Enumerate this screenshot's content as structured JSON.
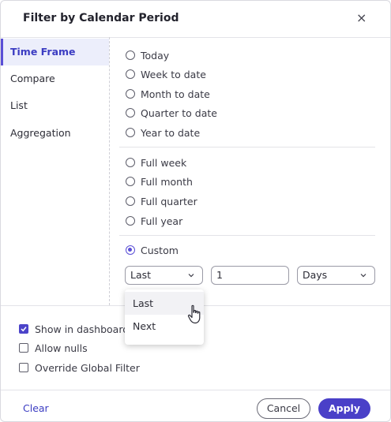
{
  "dialog": {
    "title": "Filter by Calendar Period",
    "close_icon": "×"
  },
  "sidebar": {
    "items": [
      {
        "label": "Time Frame",
        "active": true
      },
      {
        "label": "Compare"
      },
      {
        "label": "List"
      },
      {
        "label": "Aggregation"
      }
    ]
  },
  "options": {
    "group1": [
      "Today",
      "Week to date",
      "Month to date",
      "Quarter to date",
      "Year to date"
    ],
    "group2": [
      "Full week",
      "Full month",
      "Full quarter",
      "Full year"
    ],
    "custom": "Custom",
    "selected": "Custom"
  },
  "custom_fields": {
    "direction_value": "Last",
    "number_value": "1",
    "unit_value": "Days",
    "chevron": "⌵"
  },
  "dropdown": {
    "options": [
      "Last",
      "Next"
    ],
    "hovered": "Last"
  },
  "checks": [
    {
      "label": "Show in dashboard",
      "checked": true
    },
    {
      "label": "Allow nulls",
      "checked": false
    },
    {
      "label": "Override Global Filter",
      "checked": false
    }
  ],
  "footer": {
    "clear": "Clear",
    "cancel": "Cancel",
    "apply": "Apply"
  },
  "colors": {
    "accent": "#4a40c8",
    "active_bg": "#eceefb"
  }
}
